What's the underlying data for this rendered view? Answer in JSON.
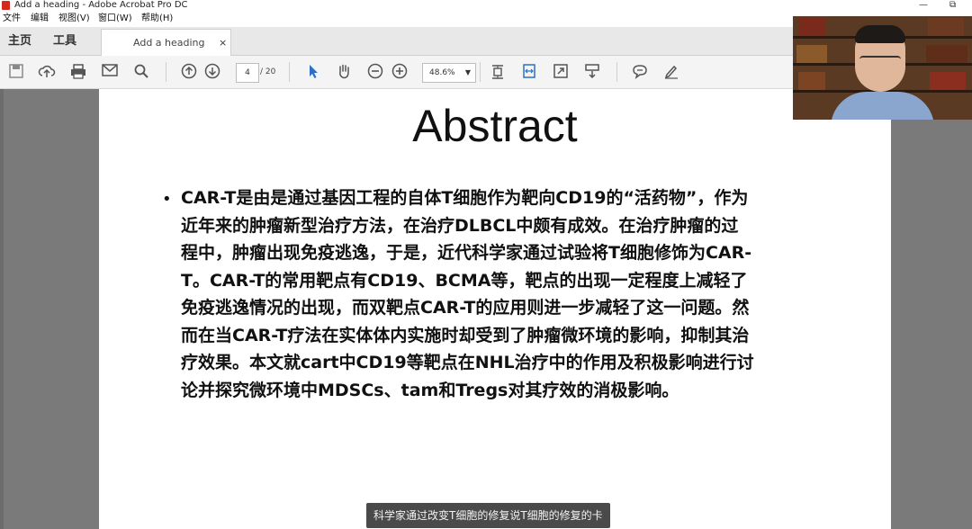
{
  "window": {
    "title": "Add a heading - Adobe Acrobat Pro DC",
    "restore_glyph": "⧉",
    "minimize_glyph": "—"
  },
  "menu": [
    "文件",
    "编辑",
    "视图(V)",
    "窗口(W)",
    "帮助(H)"
  ],
  "nav_tabs": [
    "主页",
    "工具"
  ],
  "doc_tab": {
    "label": "Add a heading",
    "close": "×"
  },
  "toolbar": {
    "icons": [
      "save-icon",
      "upload-icon",
      "print-icon",
      "email-icon",
      "search-icon",
      "page-up-icon",
      "page-down-icon",
      "cursor-icon",
      "hand-icon",
      "zoom-out-icon",
      "zoom-in-icon",
      "fit-page-icon",
      "fit-width-icon",
      "full-screen-icon",
      "scroll-icon",
      "comment-icon",
      "sign-icon"
    ],
    "page_current": "4",
    "page_total": "/ 20",
    "zoom": "48.6%"
  },
  "document": {
    "title": "Abstract",
    "bullet": "•",
    "lines": [
      "CAR-T是由是通过基因工程的自体T细胞作为靶向CD19的“活药物”，作为",
      "近年来的肿瘤新型治疗方法，在治疗DLBCL中颇有成效。在治疗肿瘤的过",
      "程中，肿瘤出现免疫逃逸，于是，近代科学家通过试验将T细胞修饰为CAR-",
      "T。CAR-T的常用靶点有CD19、BCMA等，靶点的出现一定程度上减轻了",
      "免疫逃逸情况的出现，而双靶点CAR-T的应用则进一步减轻了这一问题。然",
      "而在当CAR-T疗法在实体体内实施时却受到了肿瘤微环境的影响，抑制其治",
      "疗效果。本文就cart中CD19等靶点在NHL治疗中的作用及积极影响进行讨",
      "论并探究微环境中MDSCs、tam和Tregs对其疗效的消极影响。"
    ]
  },
  "subtitle": "科学家通过改变T细胞的修复说T细胞的修复的卡"
}
